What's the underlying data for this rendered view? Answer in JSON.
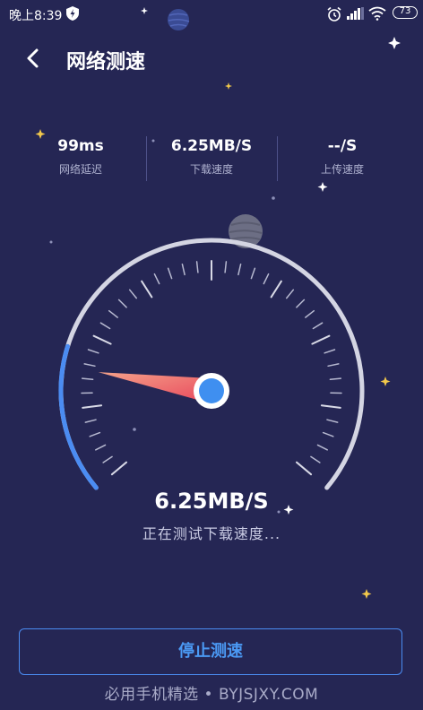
{
  "status_bar": {
    "time": "晚上8:39",
    "battery": "73"
  },
  "header": {
    "title": "网络测速"
  },
  "stats": [
    {
      "value": "99ms",
      "label": "网络延迟"
    },
    {
      "value": "6.25MB/S",
      "label": "下载速度"
    },
    {
      "value": "--/S",
      "label": "上传速度"
    }
  ],
  "gauge": {
    "progress_fraction": 0.22,
    "needle_fraction": 0.19
  },
  "speed": {
    "value": "6.25MB/S",
    "status": "正在测试下载速度..."
  },
  "actions": {
    "stop_label": "停止测速"
  },
  "watermark": "必用手机精选 • BYJSJXY.COM",
  "colors": {
    "background": "#252654",
    "accent": "#4b9af5",
    "needle": "#f06a6a"
  }
}
